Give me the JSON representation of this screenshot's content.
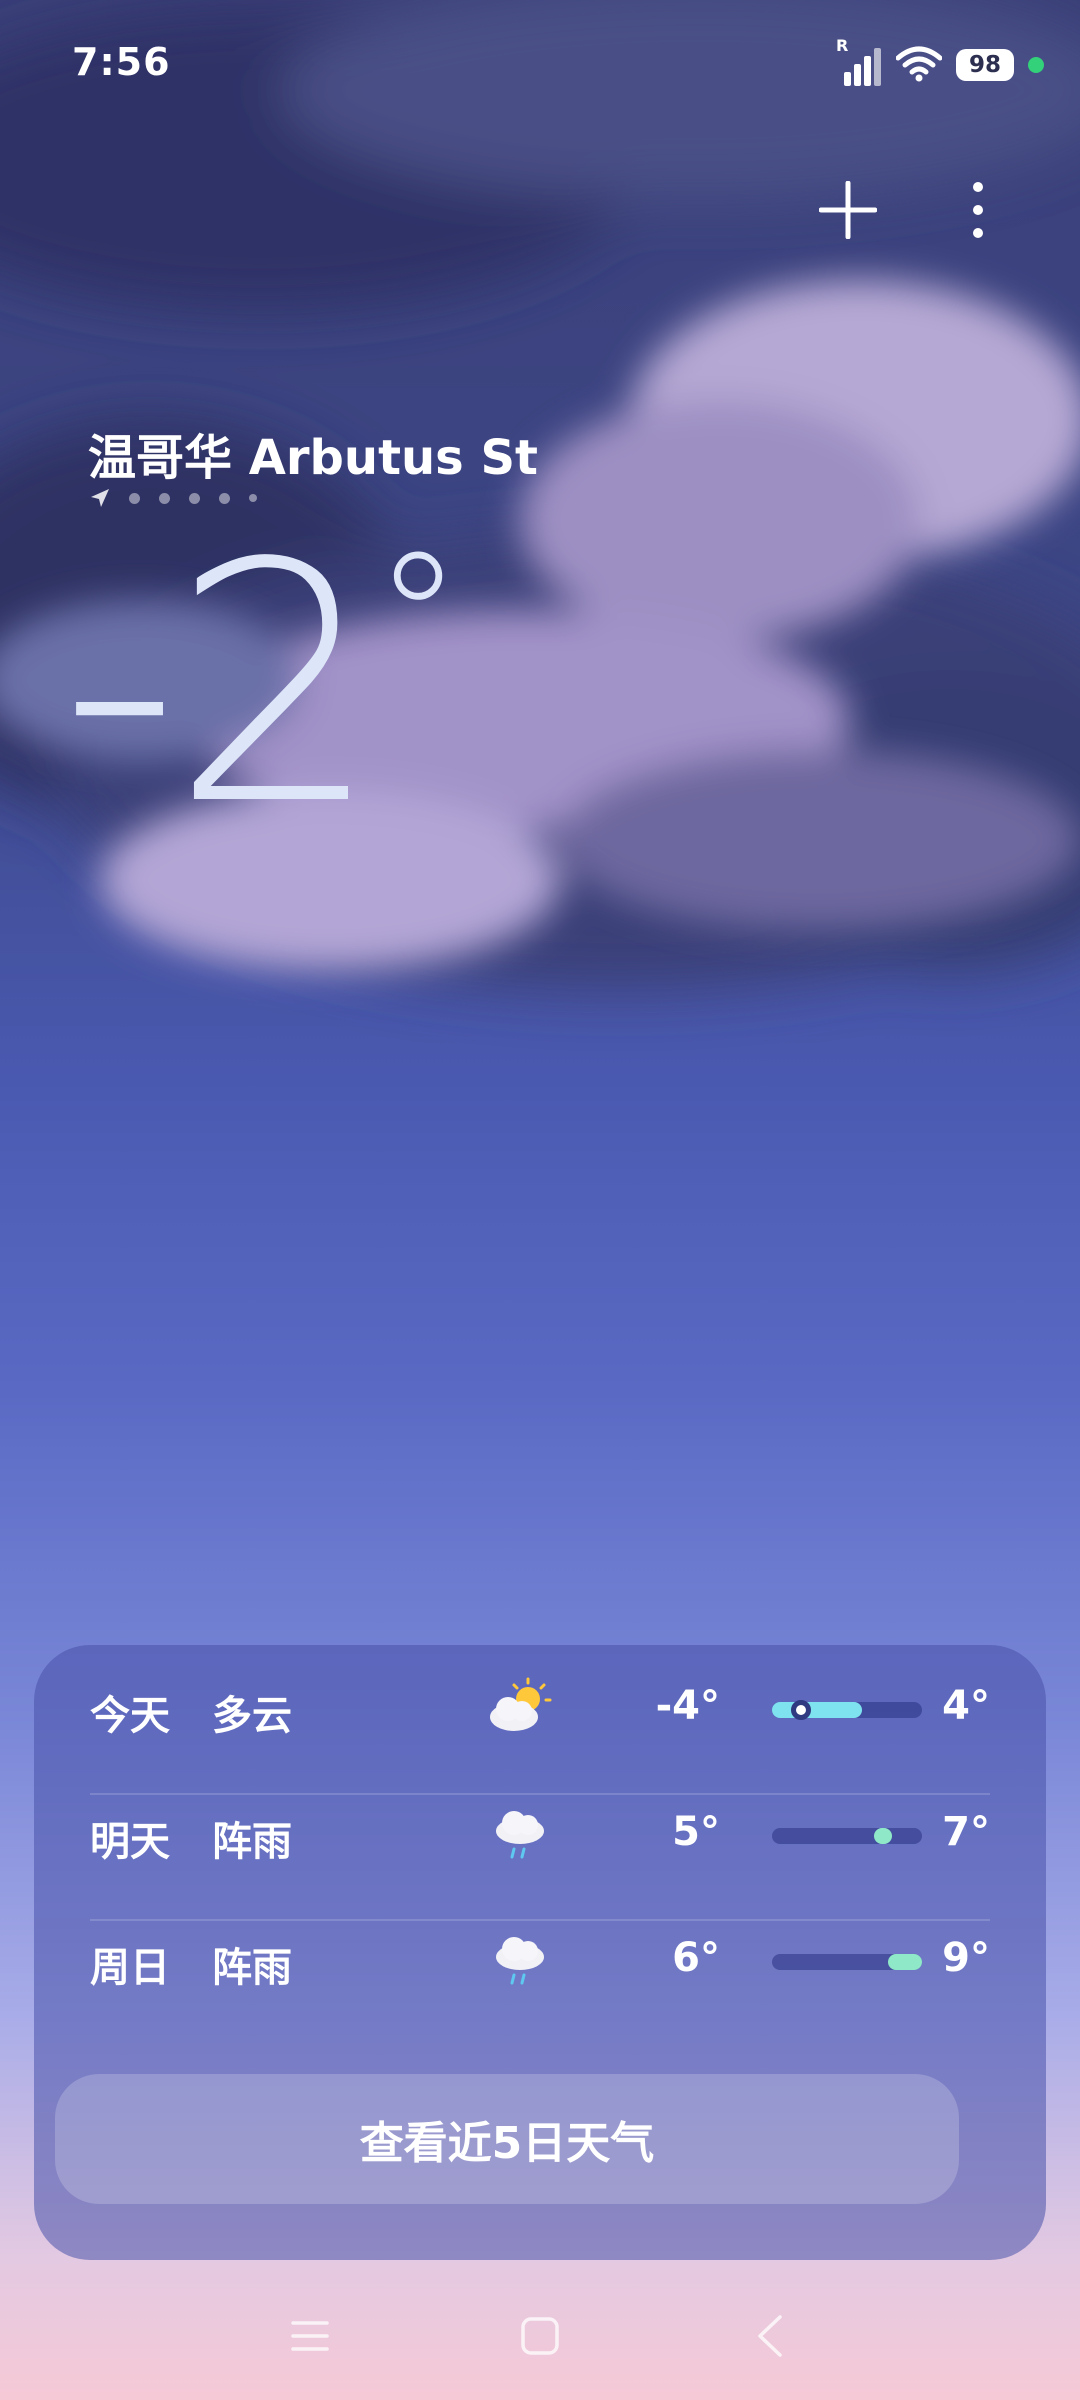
{
  "status_bar": {
    "time": "7:56",
    "roaming": "R",
    "battery": "98",
    "icons": [
      "signal-icon",
      "wifi-icon",
      "battery-icon",
      "privacy-dot-icon"
    ]
  },
  "toolbar": {
    "icons": [
      "add-icon",
      "more-vert-icon"
    ]
  },
  "location": {
    "name": "温哥华 Arbutus St",
    "icons": [
      "location-arrow-icon"
    ],
    "page_count": 5,
    "active_page": 0
  },
  "current": {
    "temperature": "-2",
    "degree": "°"
  },
  "forecast": [
    {
      "day": "今天",
      "condition": "多云",
      "icon": "partly-cloudy-icon",
      "low": "-4°",
      "high": "4°",
      "range_start": 0.0,
      "range_end": 0.6,
      "current_marker": 0.19,
      "fill_color": "#7fe3ef"
    },
    {
      "day": "明天",
      "condition": "阵雨",
      "icon": "rain-cloud-icon",
      "low": "5°",
      "high": "7°",
      "range_start": 0.68,
      "range_end": 0.8,
      "fill_color": "#8fe8c7"
    },
    {
      "day": "周日",
      "condition": "阵雨",
      "icon": "rain-cloud-icon",
      "low": "6°",
      "high": "9°",
      "range_start": 0.77,
      "range_end": 1.0,
      "fill_color": "#8fe8c7"
    }
  ],
  "five_day_button": "查看近5日天气",
  "nav_bar": {
    "icons": [
      "menu-icon",
      "home-icon",
      "back-icon"
    ]
  }
}
